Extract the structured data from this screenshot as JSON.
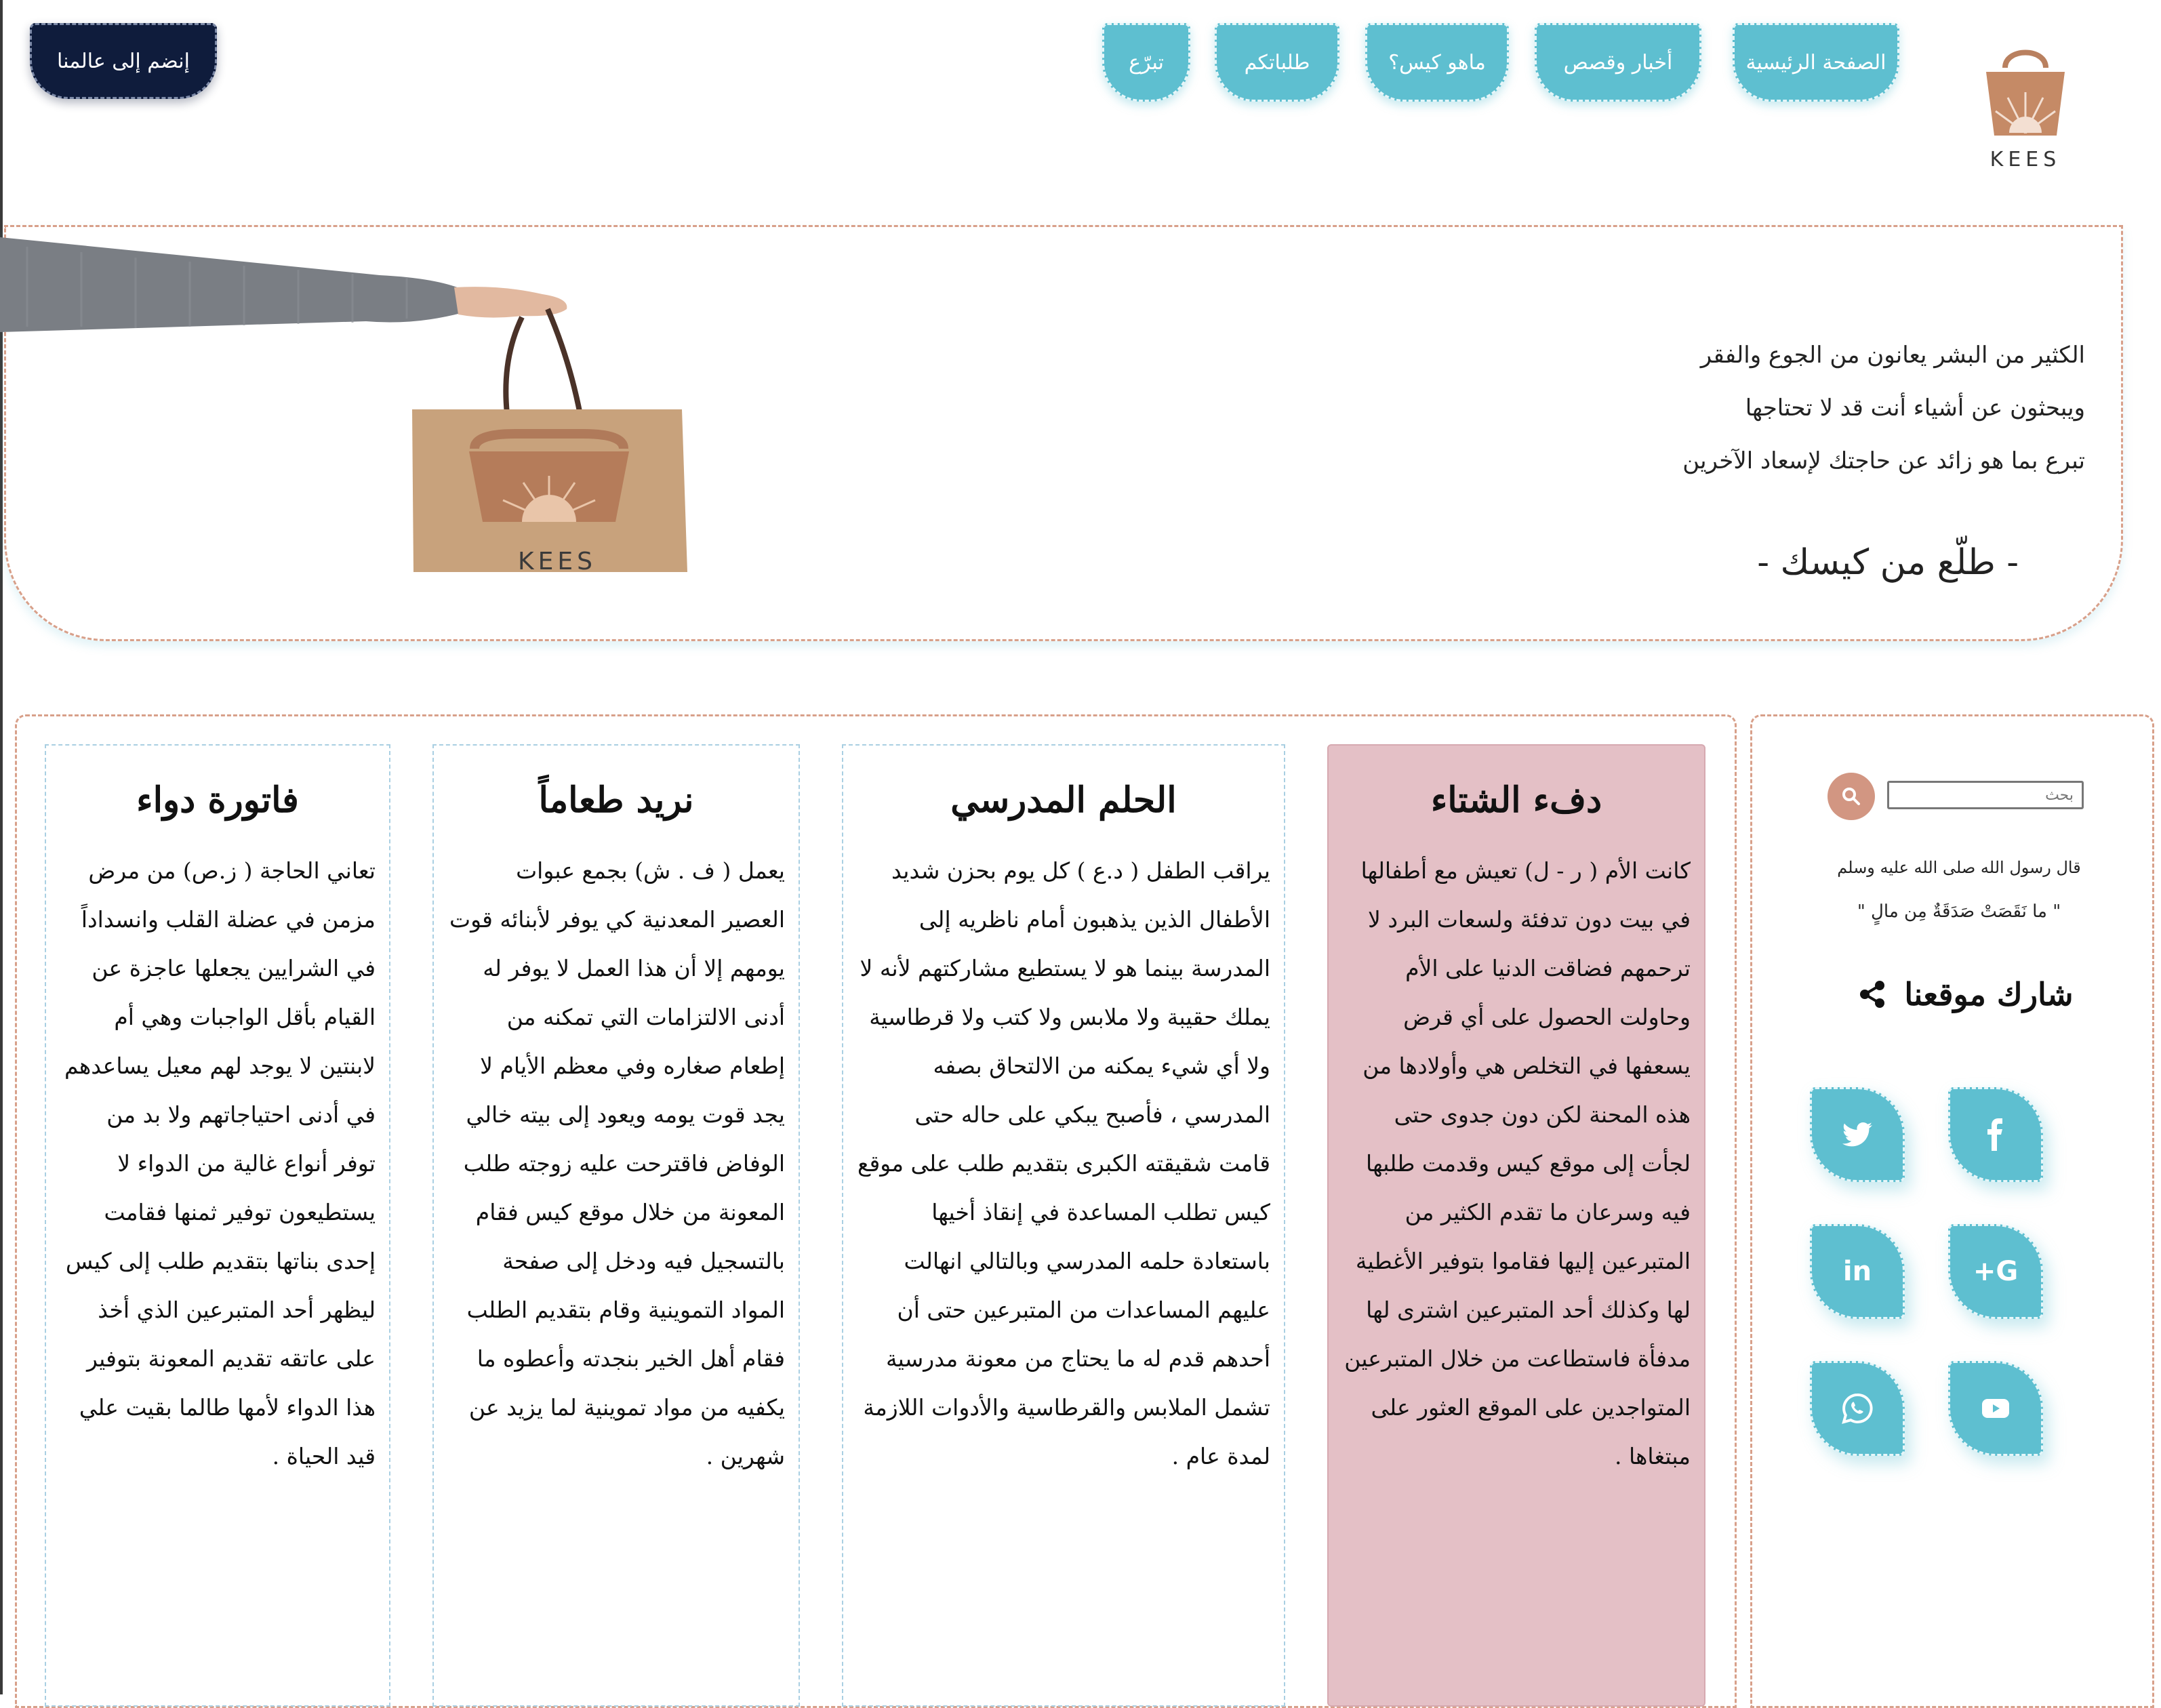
{
  "brand": {
    "logo_text": "KEES"
  },
  "nav": {
    "items": [
      {
        "label": "الصفحة الرئيسية"
      },
      {
        "label": "أخبار وقصص"
      },
      {
        "label": "ماهو كيس؟"
      },
      {
        "label": "طلباتكم"
      },
      {
        "label": "تبرّع"
      }
    ],
    "join_label": "إنضم إلى عالمنا"
  },
  "hero": {
    "lines": [
      "الكثير من البشر يعانون من الجوع والفقر",
      "ويبحثون عن أشياء أنت قد لا تحتاجها",
      "تبرع بما هو زائد عن حاجتك لإسعاد الآخرين"
    ],
    "signature": "- طلّع من كيسك -",
    "bag_text": "KEES"
  },
  "stories": [
    {
      "title": "دفء الشتاء",
      "body": "كانت الأم ( ر - ل) تعيش مع أطفالها في بيت دون تدفئة ولسعات البرد لا ترحمهم فضاقت الدنيا على الأم وحاولت الحصول على أي قرض يسعفها في التخلص هي وأولادها من هذه المحنة لكن دون جدوى حتى لجأت إلى موقع كيس وقدمت طلبها فيه وسرعان ما تقدم الكثير من المتبرعين إليها فقاموا بتوفير الأغطية لها وكذلك أحد المتبرعين اشترى لها مدفأة فاستطاعت من خلال المتبرعين المتواجدين على الموقع العثور على مبتغاها ."
    },
    {
      "title": "الحلم المدرسي",
      "body": "يراقب الطفل ( د.ع ) كل يوم بحزن شديد الأطفال الذين يذهبون أمام ناظريه إلى المدرسة بينما هو لا يستطيع مشاركتهم لأنه لا يملك حقيبة ولا ملابس ولا كتب ولا قرطاسية ولا أي شيء يمكنه من الالتحاق بصفه المدرسي ، فأصبح يبكي على حاله حتى قامت شقيقته الكبرى بتقديم طلب على موقع كيس تطلب المساعدة في إنقاذ أخيها باستعادة حلمه المدرسي وبالتالي انهالت عليهم المساعدات من المتبرعين حتى أن أحدهم قدم له ما يحتاج من معونة مدرسية تشمل الملابس والقرطاسية والأدوات اللازمة لمدة عام ."
    },
    {
      "title": "نريد طعاماً",
      "body": "يعمل ( ف . ش) بجمع عبوات العصير المعدنية كي يوفر لأبنائه قوت يومهم إلا أن هذا العمل لا يوفر له أدنى الالتزامات التي تمكنه من إطعام صغاره وفي معظم الأيام لا يجد قوت يومه ويعود إلى بيته خالي الوفاض فاقترحت عليه زوجته طلب المعونة من خلال موقع كيس فقام بالتسجيل فيه ودخل إلى صفحة المواد التموينية وقام بتقديم الطلب فقام أهل الخير بنجدته وأعطوه ما يكفيه من مواد تموينية لما يزيد عن شهرين ."
    },
    {
      "title": "فاتورة دواء",
      "body": "تعاني الحاجة ( ز.ص) من مرض مزمن في عضلة القلب وانسداداً في الشرايين يجعلها عاجزة عن القيام بأقل الواجبات وهي أم لابنتين لا يوجد لهم معيل يساعدهم في أدنى احتياجاتهم ولا بد من توفر أنواع غالية من الدواء لا يستطيعون توفير ثمنها فقامت إحدى بناتها بتقديم طلب إلى كيس ليظهر أحد المتبرعين الذي أخذ على عاتقه تقديم المعونة بتوفير هذا الدواء لأمها طالما بقيت علي قيد الحياة ."
    }
  ],
  "sidebar": {
    "search_placeholder": "بحث",
    "hadith_intro": "قال رسول الله صلى الله عليه وسلم",
    "hadith_text": "\" ما نَقَصَتْ صَدَقَةٌ مِن مالٍ \"",
    "share_title": "شارك موقعنا",
    "social": [
      {
        "icon": "facebook-icon"
      },
      {
        "icon": "twitter-icon"
      },
      {
        "icon": "google-plus-icon",
        "label": "G+"
      },
      {
        "icon": "linkedin-icon",
        "label": "in"
      },
      {
        "icon": "youtube-icon"
      },
      {
        "icon": "whatsapp-icon"
      }
    ]
  },
  "colors": {
    "nav_teal": "#5ebfd0",
    "join_navy": "#0f1c3c",
    "accent_brown": "#d29682",
    "highlight_pink": "#e4c0c6",
    "border_dashed": "#d8a08a"
  }
}
